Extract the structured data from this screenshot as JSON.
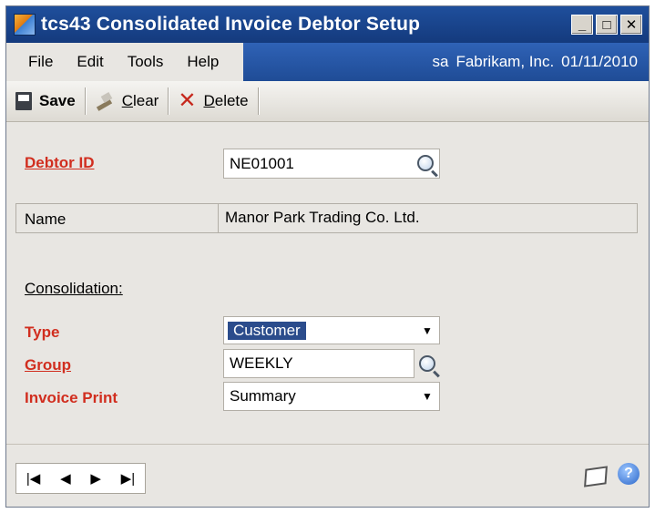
{
  "window": {
    "title": "tcs43 Consolidated Invoice Debtor Setup",
    "controls": {
      "minimize": "_",
      "maximize": "□",
      "close": "✕"
    }
  },
  "menu": {
    "items": [
      "File",
      "Edit",
      "Tools",
      "Help"
    ],
    "status_user": "sa",
    "status_company": "Fabrikam, Inc.",
    "status_date": "01/11/2010"
  },
  "toolbar": {
    "save_label": "Save",
    "clear_label_prefix": "C",
    "clear_label_rest": "lear",
    "delete_label_prefix": "D",
    "delete_label_rest": "elete"
  },
  "form": {
    "debtor_id_label": "Debtor ID",
    "debtor_id_value": "NE01001",
    "name_label": "Name",
    "name_value": "Manor Park Trading Co. Ltd.",
    "consolidation_label": "Consolidation:",
    "type_label": "Type",
    "type_value": "Customer",
    "group_label": "Group",
    "group_value": "WEEKLY",
    "invoice_print_label": "Invoice Print",
    "invoice_print_value": "Summary"
  },
  "footer": {
    "nav": {
      "first": "|◀",
      "prev": "◀",
      "next": "▶",
      "last": "▶|"
    },
    "help_glyph": "?"
  },
  "icons": [
    "app-icon",
    "save-icon",
    "clear-icon",
    "delete-icon",
    "lookup-icon",
    "dropdown-arrow-icon",
    "note-icon",
    "help-icon"
  ],
  "colors": {
    "title_bar": "#1f4f9c",
    "required_label": "#d12e1f",
    "selection": "#2b4c8c",
    "background": "#e8e6e2"
  }
}
